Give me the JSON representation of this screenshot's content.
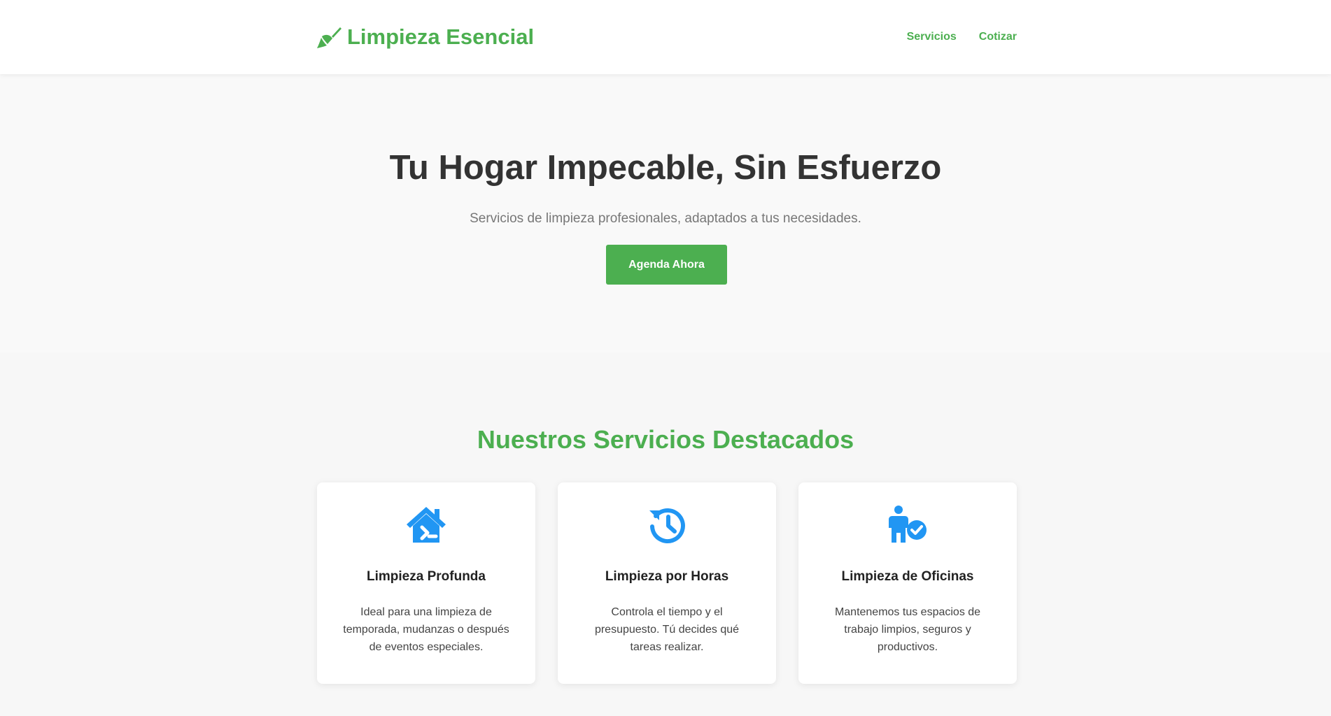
{
  "header": {
    "brand_name": "Limpieza Esencial",
    "brand_icon": "broom-icon",
    "nav": [
      {
        "label": "Servicios"
      },
      {
        "label": "Cotizar"
      }
    ]
  },
  "hero": {
    "title": "Tu Hogar Impecable, Sin Esfuerzo",
    "subtitle": "Servicios de limpieza profesionales, adaptados a tus necesidades.",
    "cta_label": "Agenda Ahora"
  },
  "services": {
    "title": "Nuestros Servicios Destacados",
    "cards": [
      {
        "icon": "house-icon",
        "title": "Limpieza Profunda",
        "description": "Ideal para una limpieza de temporada, mudanzas o después de eventos especiales."
      },
      {
        "icon": "clock-history-icon",
        "title": "Limpieza por Horas",
        "description": "Controla el tiempo y el presupuesto. Tú decides qué tareas realizar."
      },
      {
        "icon": "person-check-icon",
        "title": "Limpieza de Oficinas",
        "description": "Mantenemos tus espacios de trabajo limpios, seguros y productivos."
      }
    ]
  },
  "colors": {
    "brand_green": "#4caf50",
    "icon_blue": "#2196f3",
    "text_dark": "#333333",
    "text_muted": "#777777"
  }
}
